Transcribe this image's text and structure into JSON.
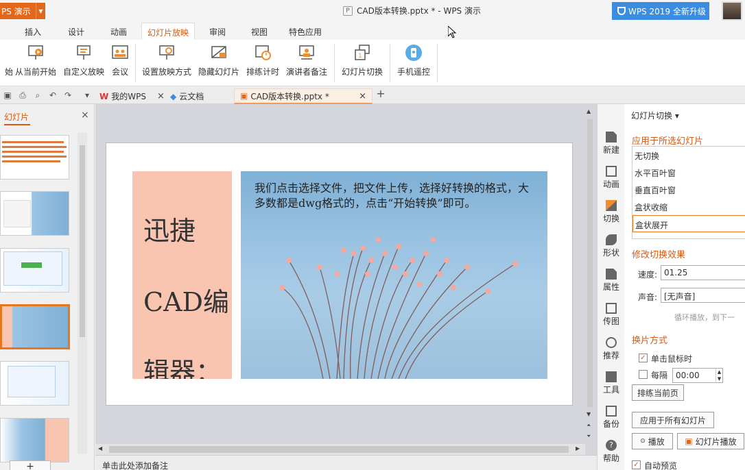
{
  "titlebar": {
    "app_label": "PS 演示",
    "doc_title": "CAD版本转换.pptx * - WPS 演示",
    "upgrade_label": "WPS 2019 全新升级"
  },
  "ribbon_tabs": [
    "插入",
    "设计",
    "动画",
    "幻灯片放映",
    "审阅",
    "视图",
    "特色应用"
  ],
  "ribbon_buttons": {
    "from_start": "始",
    "from_current": "从当前开始",
    "custom_show": "自定义放映",
    "meeting": "会议",
    "setup_show": "设置放映方式",
    "hide_slide": "隐藏幻灯片",
    "rehearse": "排练计时",
    "presenter_notes": "演讲者备注",
    "slide_transition": "幻灯片切换",
    "phone_remote": "手机遥控"
  },
  "doc_tabs": {
    "my_wps": "我的WPS",
    "cloud_docs": "云文档",
    "current": "CAD版本转换.pptx *"
  },
  "left_panel": {
    "title": "幻灯片"
  },
  "slide": {
    "left_lines": [
      "迅捷",
      "CAD编",
      "辑器："
    ],
    "body_text": "我们点击选择文件，把文件上传，选择好转换的格式，大多数都是dwg格式的，点击“开始转换”即可。"
  },
  "notes_placeholder": "单击此处添加备注",
  "right_sidebar": [
    "新建",
    "动画",
    "切换",
    "形状",
    "属性",
    "传图",
    "推荐",
    "工具",
    "备份",
    "帮助"
  ],
  "task_pane": {
    "header": "幻灯片切换",
    "apply_section": "应用于所选幻灯片",
    "transitions": [
      "无切换",
      "水平百叶窗",
      "垂直百叶窗",
      "盒状收缩",
      "盒状展开"
    ],
    "selected_transition": "盒状展开",
    "modify_section": "修改切换效果",
    "speed_label": "速度:",
    "speed_value": "01.25",
    "sound_label": "声音:",
    "sound_value": "[无声音]",
    "loop_hint": "循环播放，到下一",
    "advance_section": "换片方式",
    "on_click_label": "单击鼠标时",
    "on_click_checked": true,
    "every_label": "每隔",
    "every_value": "00:00",
    "rehearse_current": "排练当前页",
    "apply_all": "应用于所有幻灯片",
    "play": "播放",
    "slideshow": "幻灯片播放",
    "auto_preview": "自动预览"
  },
  "colors": {
    "accent": "#d65a12",
    "app_orange": "#e5671a",
    "upgrade_blue": "#3a8de0",
    "slide_orange_block": "#f9c5b0"
  }
}
